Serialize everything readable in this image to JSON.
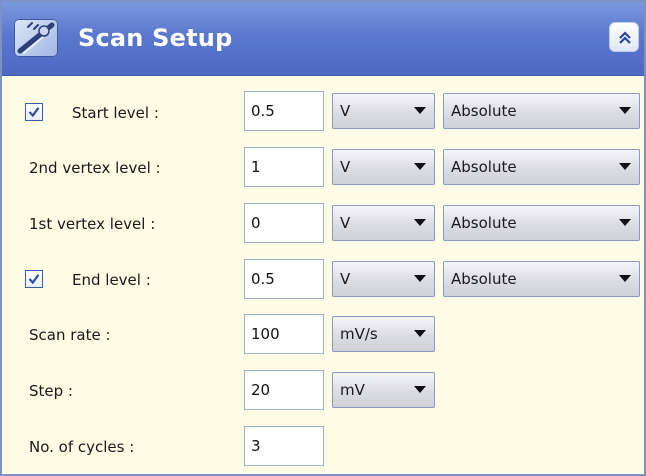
{
  "header": {
    "title": "Scan Setup",
    "logo_icon": "scan-tool-icon",
    "collapse_icon": "double-chevron-up-icon"
  },
  "rows": [
    {
      "label": "Start level :",
      "checked": true,
      "value": "0.5",
      "unit": "V",
      "mode": "Absolute"
    },
    {
      "label": "2nd vertex level :",
      "value": "1",
      "unit": "V",
      "mode": "Absolute"
    },
    {
      "label": "1st vertex level :",
      "value": "0",
      "unit": "V",
      "mode": "Absolute"
    },
    {
      "label": "End level :",
      "checked": true,
      "value": "0.5",
      "unit": "V",
      "mode": "Absolute"
    },
    {
      "label": "Scan rate :",
      "value": "100",
      "unit": "mV/s"
    },
    {
      "label": "Step :",
      "value": "20",
      "unit": "mV"
    },
    {
      "label": "No. of cycles :",
      "value": "3"
    }
  ],
  "colors": {
    "header": "#5b78cf",
    "panel_bg": "#fdfde6",
    "border": "#7d90c8"
  }
}
